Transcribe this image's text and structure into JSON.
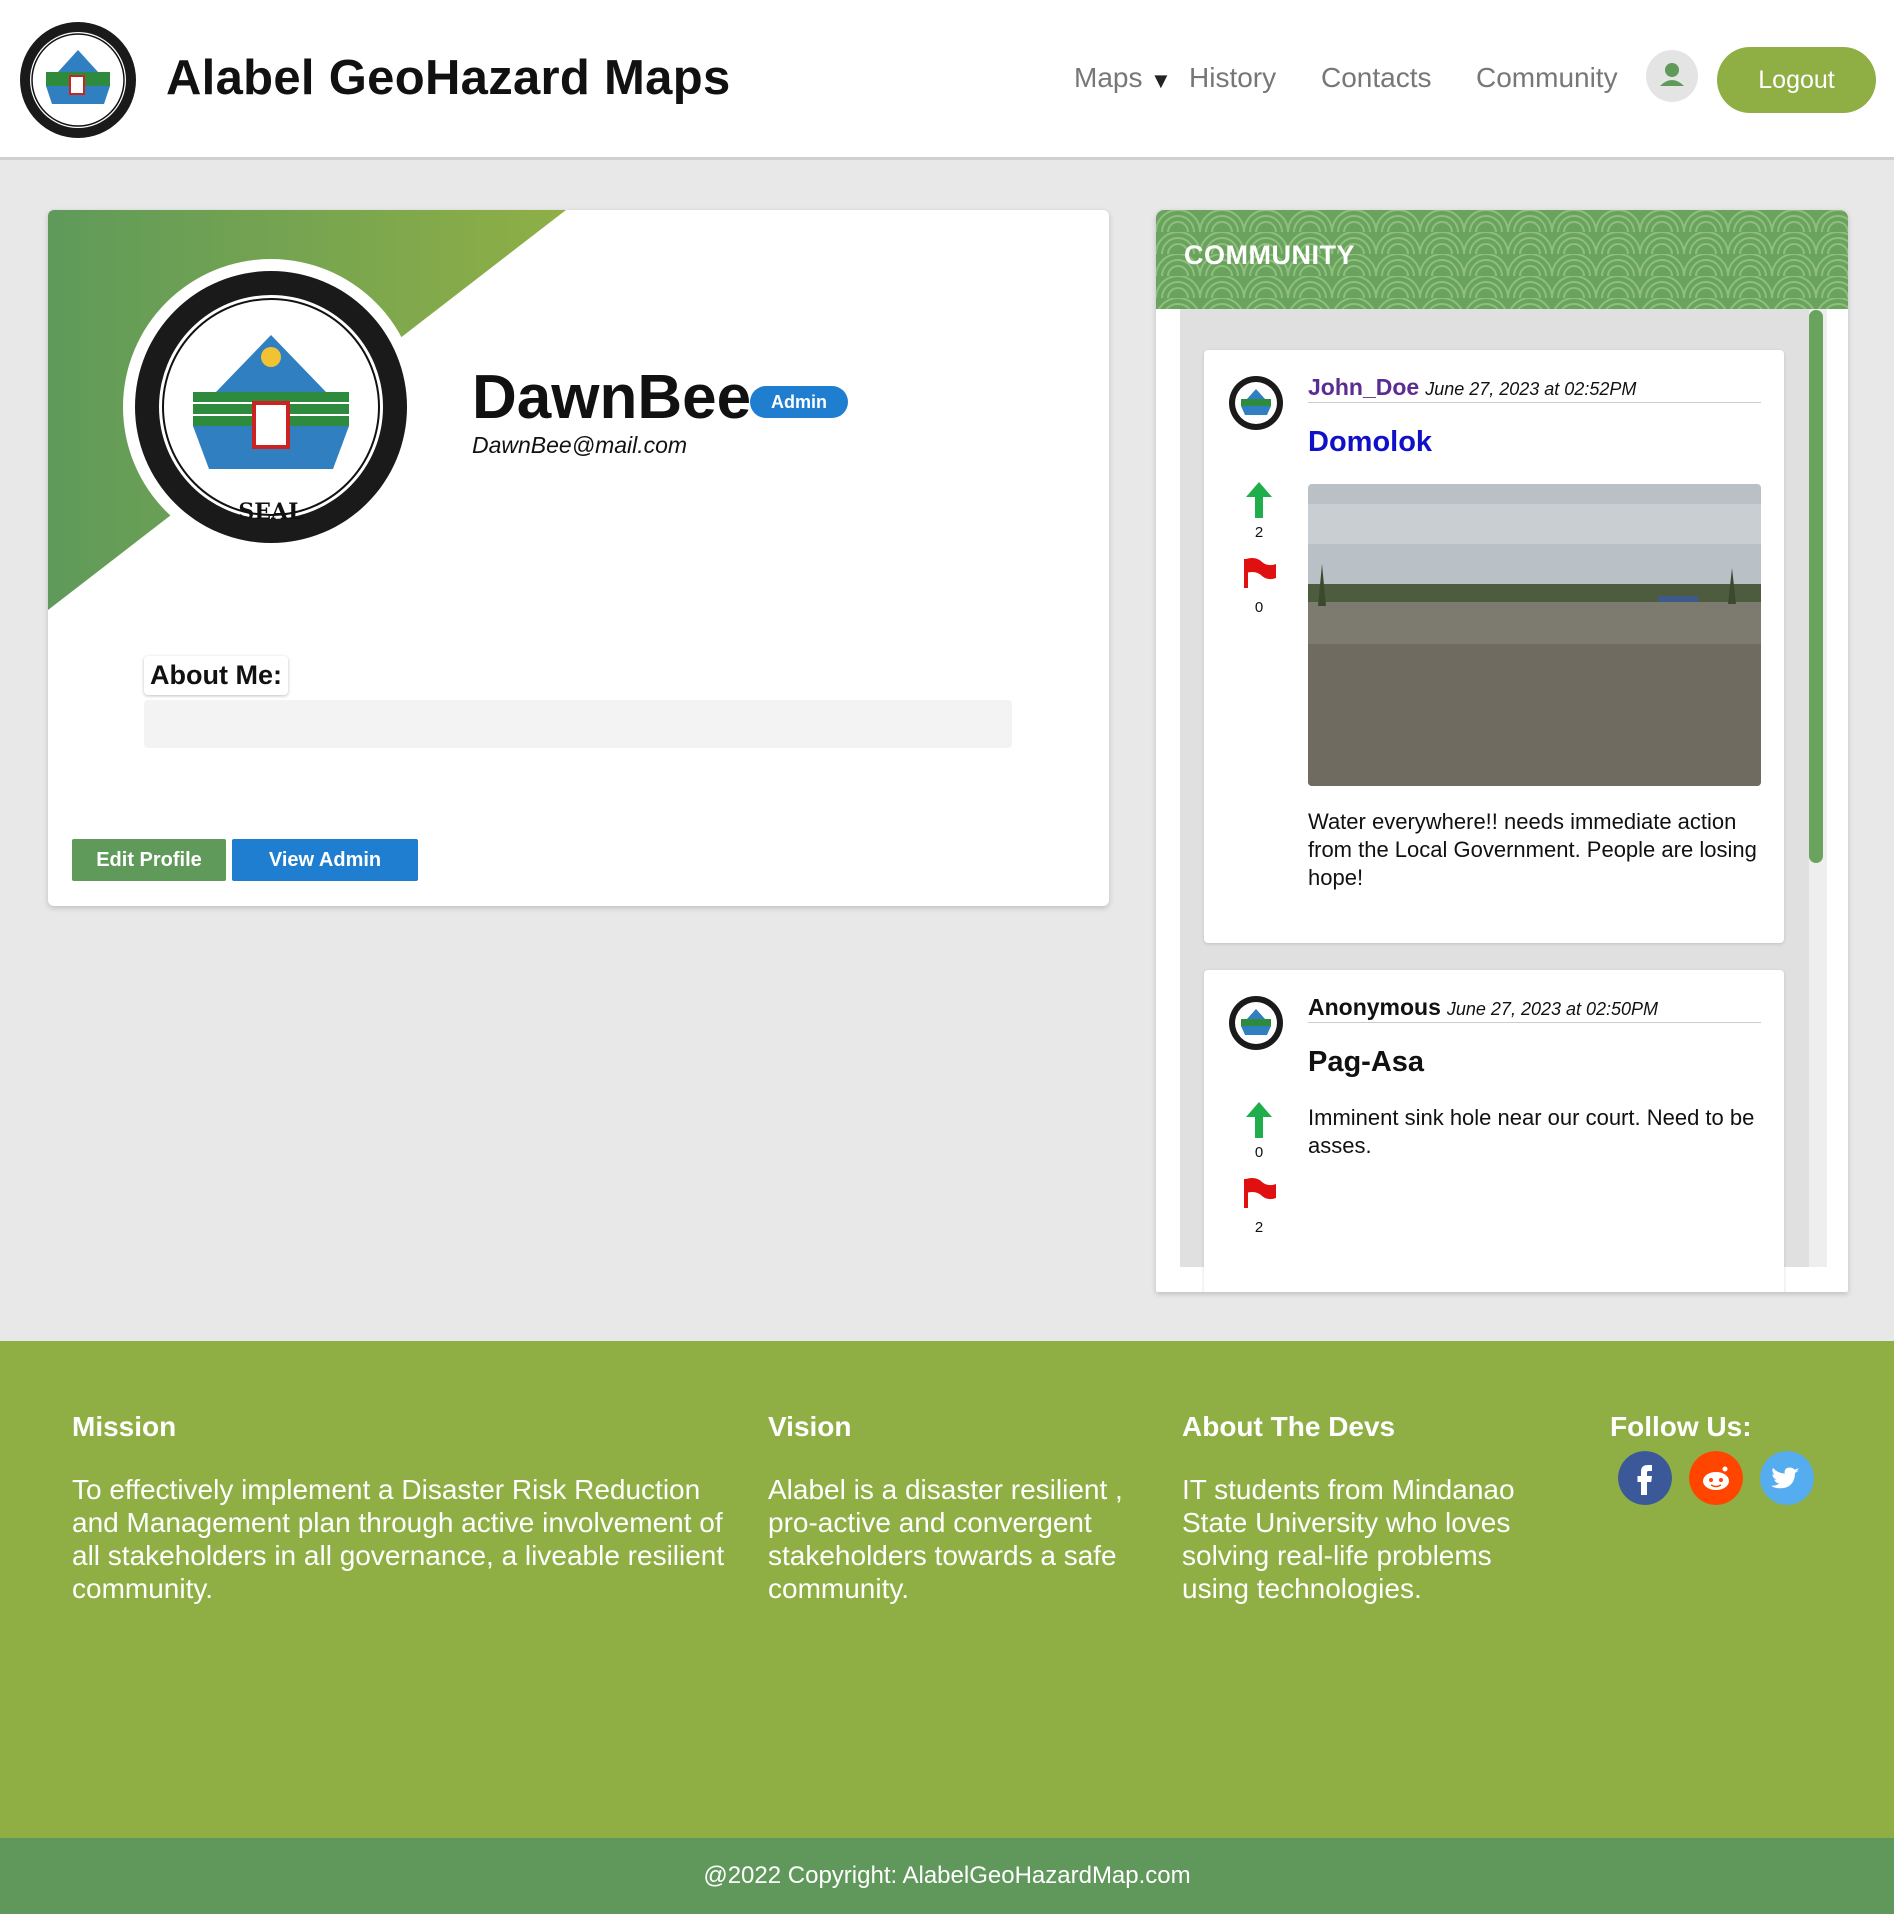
{
  "header": {
    "site_title": "Alabel GeoHazard Maps",
    "logo_icon": "municipal-seal-icon",
    "nav": {
      "maps": "Maps",
      "maps_caret": "▼",
      "history": "History",
      "contacts": "Contacts",
      "community": "Community"
    },
    "user_icon": "user-icon",
    "logout": "Logout"
  },
  "profile": {
    "username": "DawnBee",
    "role_badge": "Admin",
    "email": "DawnBee@mail.com",
    "about_label": "About Me:",
    "about_value": "",
    "edit_button": "Edit Profile",
    "view_admin_button": "View Admin"
  },
  "community": {
    "title": "COMMUNITY",
    "posts": [
      {
        "author": "John_Doe",
        "date": "June 27, 2023 at 02:52PM",
        "title": "Domolok",
        "upvotes": "2",
        "flags": "0",
        "body": "Water everywhere!! needs immediate action from the Local Government. People are losing hope!",
        "author_color": "#5b2c91",
        "title_color": "#1010c8"
      },
      {
        "author": "Anonymous",
        "date": "June 27, 2023 at 02:50PM",
        "title": "Pag-Asa",
        "upvotes": "0",
        "flags": "2",
        "body": "Imminent sink hole near our court. Need to be asses.",
        "author_color": "#111111",
        "title_color": "#111111"
      }
    ]
  },
  "footer": {
    "mission_heading": "Mission",
    "mission_text": "To effectively implement a Disaster Risk Reduction and Management plan through active involvement of all stakeholders in all governance, a liveable resilient community.",
    "vision_heading": "Vision",
    "vision_text": "Alabel is a disaster resilient , pro-active and convergent stakeholders towards a safe community.",
    "devs_heading": "About The Devs",
    "devs_text": "IT students from Mindanao State University who loves solving real-life problems using technologies.",
    "follow_heading": "Follow Us:",
    "social_icons": [
      "facebook-icon",
      "reddit-icon",
      "twitter-icon"
    ],
    "copyright": "@2022 Copyright: AlabelGeoHazardMap.com"
  },
  "colors": {
    "accent_green": "#8faf45",
    "dark_green": "#60985c",
    "link_blue": "#1f7ed0",
    "upvote_green": "#1fae4b",
    "flag_red": "#e01010"
  }
}
